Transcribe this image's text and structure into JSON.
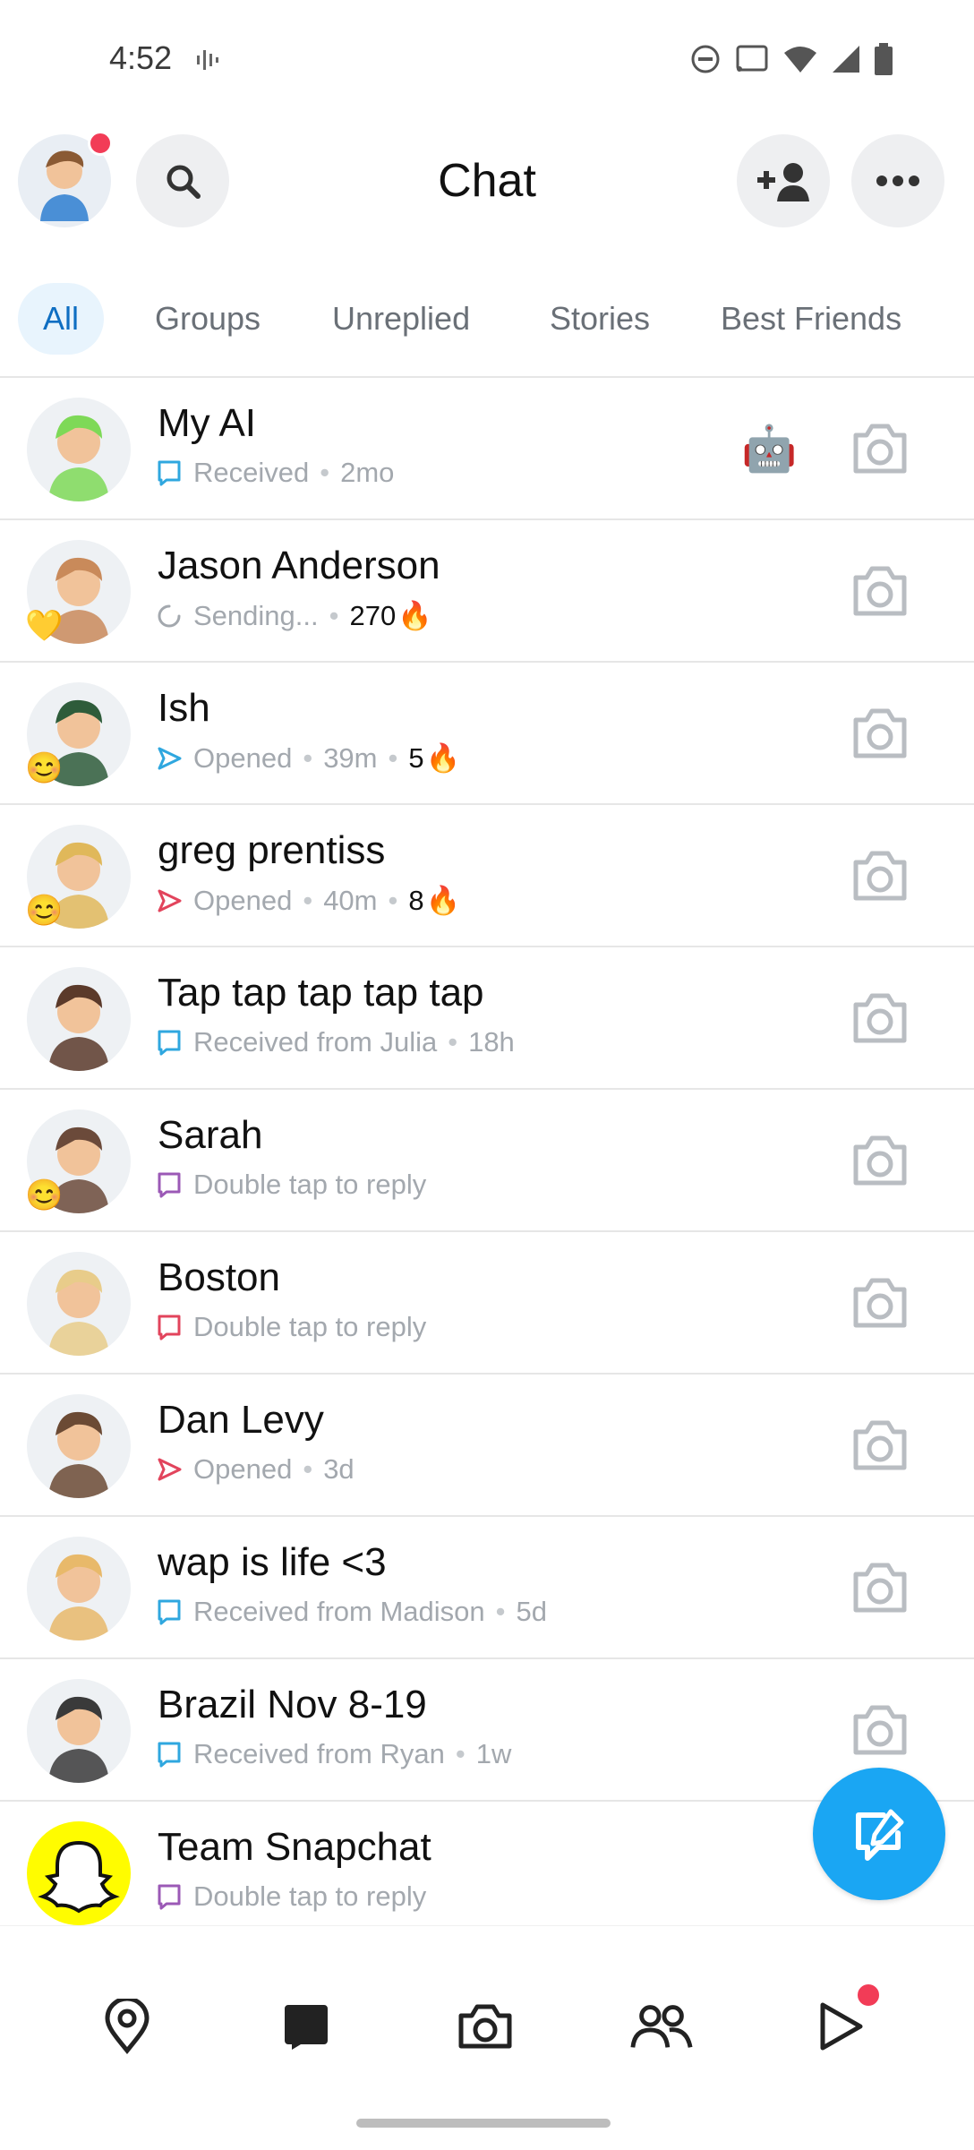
{
  "status_bar": {
    "time": "4:52"
  },
  "header": {
    "title": "Chat"
  },
  "tabs": [
    "All",
    "Groups",
    "Unreplied",
    "Stories",
    "Best Friends"
  ],
  "chats": [
    {
      "name": "My AI",
      "status": "Received",
      "time": "2mo",
      "streak": "",
      "emoji": "",
      "badge": "🤖",
      "status_color": "#2fa7df",
      "status_icon": "chat-icon",
      "avatar_color": "#7ed957"
    },
    {
      "name": "Jason Anderson",
      "status": "Sending...",
      "time": "",
      "streak": "270",
      "emoji": "💛",
      "badge": "",
      "status_color": "#a3a8ae",
      "status_icon": "sending-icon",
      "avatar_color": "#c98a5a"
    },
    {
      "name": "Ish",
      "status": "Opened",
      "time": "39m",
      "streak": "5",
      "emoji": "😊",
      "badge": "",
      "status_color": "#2fa7df",
      "status_icon": "opened-arrow-icon",
      "avatar_color": "#2e5c3a"
    },
    {
      "name": "greg prentiss",
      "status": "Opened",
      "time": "40m",
      "streak": "8",
      "emoji": "😊",
      "badge": "",
      "status_color": "#e2445c",
      "status_icon": "opened-arrow-icon",
      "avatar_color": "#e0b85a"
    },
    {
      "name": "Tap tap tap tap tap",
      "status": "Received from Julia",
      "time": "18h",
      "streak": "",
      "emoji": "",
      "badge": "",
      "status_color": "#2fa7df",
      "status_icon": "chat-icon",
      "avatar_color": "#5b3a2a"
    },
    {
      "name": "Sarah",
      "status": "Double tap to reply",
      "time": "",
      "streak": "",
      "emoji": "😊",
      "badge": "",
      "status_color": "#9b59b6",
      "status_icon": "chat-icon",
      "avatar_color": "#6b4a3a"
    },
    {
      "name": "Boston",
      "status": "Double tap to reply",
      "time": "",
      "streak": "",
      "emoji": "",
      "badge": "",
      "status_color": "#e2445c",
      "status_icon": "chat-icon",
      "avatar_color": "#e8cc8a"
    },
    {
      "name": "Dan Levy",
      "status": "Opened",
      "time": "3d",
      "streak": "",
      "emoji": "",
      "badge": "",
      "status_color": "#e2445c",
      "status_icon": "opened-arrow-icon",
      "avatar_color": "#6b4a34"
    },
    {
      "name": "wap is life <3",
      "status": "Received from Madison",
      "time": "5d",
      "streak": "",
      "emoji": "",
      "badge": "",
      "status_color": "#2fa7df",
      "status_icon": "chat-icon",
      "avatar_color": "#e8b96a"
    },
    {
      "name": "Brazil Nov 8-19",
      "status": "Received from Ryan",
      "time": "1w",
      "streak": "",
      "emoji": "",
      "badge": "",
      "status_color": "#2fa7df",
      "status_icon": "chat-icon",
      "avatar_color": "#3a3a3a"
    },
    {
      "name": "Team Snapchat",
      "status": "Double tap to reply",
      "time": "",
      "streak": "",
      "emoji": "",
      "badge": "",
      "status_color": "#9b59b6",
      "status_icon": "chat-icon",
      "avatar_color": "#fffc00"
    }
  ],
  "nav": [
    "map-icon",
    "chat-icon",
    "camera-icon",
    "friends-icon",
    "stories-play-icon"
  ],
  "colors": {
    "accent": "#1aa6f3",
    "notification": "#f23c57",
    "tab_active_bg": "#e8f4fd",
    "tab_active_text": "#0e6ec2"
  }
}
